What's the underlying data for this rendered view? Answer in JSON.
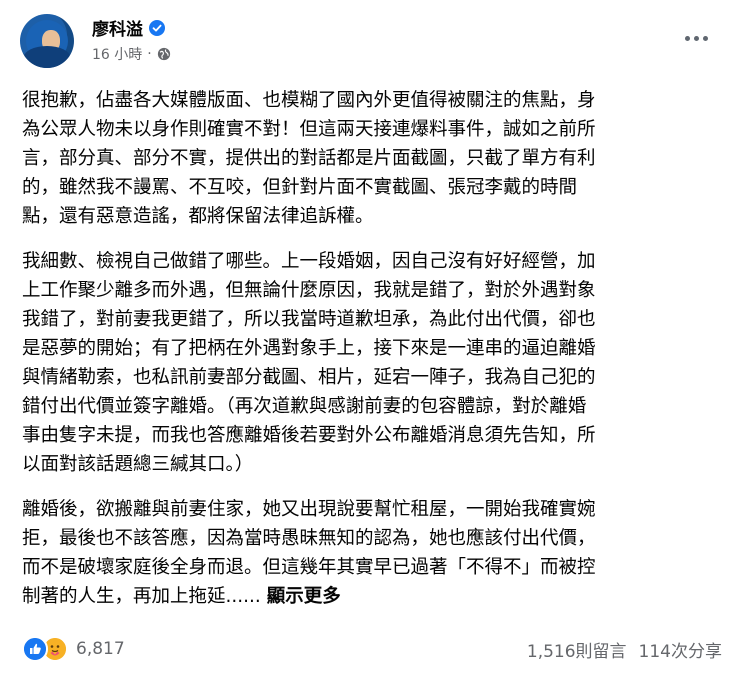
{
  "post": {
    "author": "廖科溢",
    "time": "16 小時",
    "paragraphs": [
      "很抱歉，佔盡各大媒體版面、也模糊了國內外更值得被關注的焦點，身\n為公眾人物未以身作則確實不對！但這兩天接連爆料事件，誠如之前所\n言，部分真、部分不實，提供出的對話都是片面截圖，只截了單方有利\n的，雖然我不謾罵、不互咬，但針對片面不實截圖、張冠李戴的時間\n點，還有惡意造謠，都將保留法律追訴權。",
      "我細數、檢視自己做錯了哪些。上一段婚姻，因自己沒有好好經營，加\n上工作聚少離多而外遇，但無論什麼原因，我就是錯了，對於外遇對象\n我錯了，對前妻我更錯了，所以我當時道歉坦承，為此付出代價，卻也\n是惡夢的開始；有了把柄在外遇對象手上，接下來是一連串的逼迫離婚\n與情緒勒索，也私訊前妻部分截圖、相片，延宕一陣子，我為自己犯的\n錯付出代價並簽字離婚。（再次道歉與感謝前妻的包容體諒，對於離婚\n事由隻字未提，而我也答應離婚後若要對外公布離婚消息須先告知，所\n以面對該話題總三緘其口。）",
      "離婚後，欲搬離與前妻住家，她又出現說要幫忙租屋，一開始我確實婉\n拒，最後也不該答應，因為當時愚昧無知的認為，她也應該付出代價，\n而不是破壞家庭後全身而退。但這幾年其實早已過著「不得不」而被控\n制著的人生，再加上拖延......"
    ],
    "see_more": "顯示更多",
    "reaction_count": "6,817",
    "comments": "1,516則留言",
    "shares": "114次分享"
  },
  "icons": {
    "verified": "verified-badge-icon",
    "audience": "globe-icon",
    "more": "more-options-icon",
    "like": "like-reaction-icon",
    "care": "care-reaction-icon"
  },
  "colors": {
    "accent": "#1877f2",
    "secondary_text": "#65676b",
    "care": "#f7b125"
  }
}
